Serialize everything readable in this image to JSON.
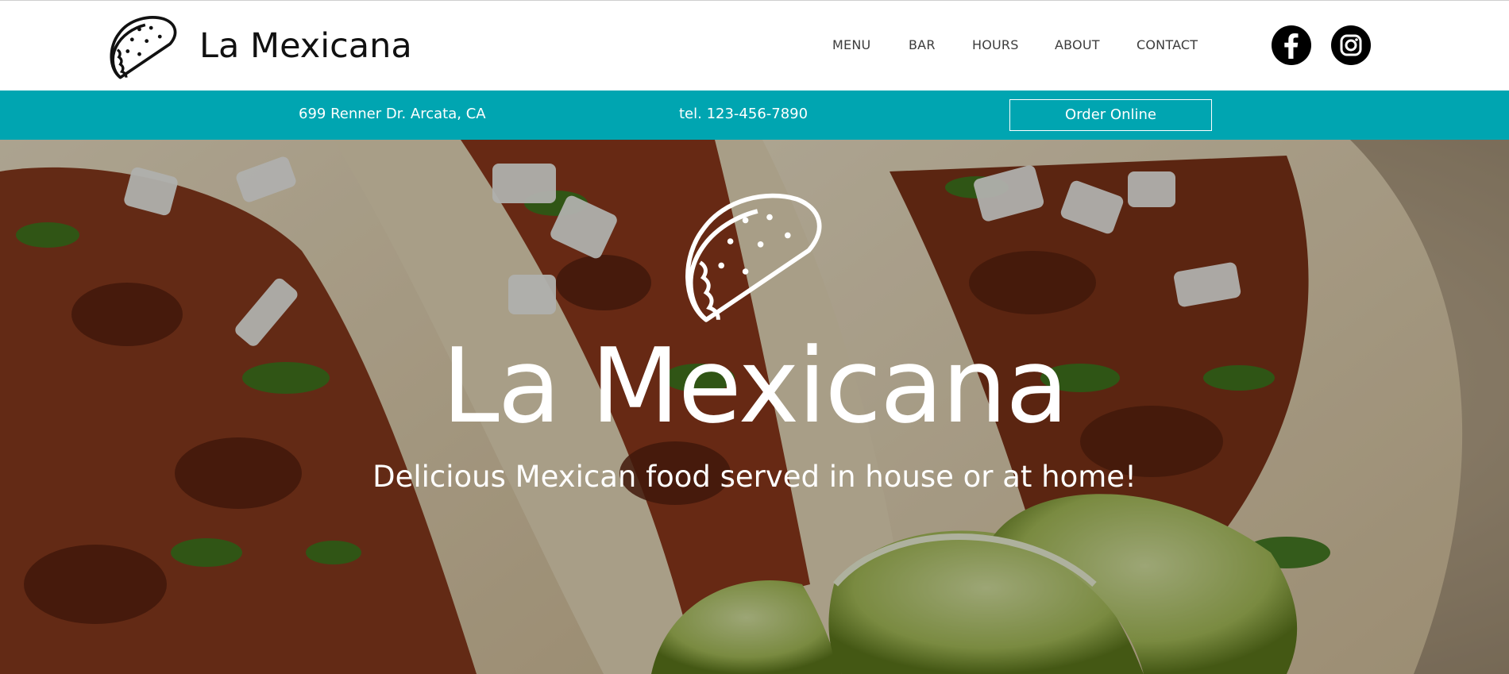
{
  "header": {
    "brand_name": "La Mexicana",
    "logo_icon": "taco-icon",
    "nav": [
      {
        "label": "MENU"
      },
      {
        "label": "BAR"
      },
      {
        "label": "HOURS"
      },
      {
        "label": "ABOUT"
      },
      {
        "label": "CONTACT"
      }
    ],
    "social": [
      {
        "icon": "facebook-icon"
      },
      {
        "icon": "instagram-icon"
      }
    ]
  },
  "info_bar": {
    "address": "699 Renner Dr. Arcata, CA",
    "phone": "tel. 123-456-7890",
    "order_label": "Order Online",
    "background_color": "#00a5b1"
  },
  "hero": {
    "logo_icon": "taco-icon",
    "title": "La Mexicana",
    "tagline": "Delicious Mexican food served in house or at home!",
    "background_image": "tacos-photo"
  }
}
